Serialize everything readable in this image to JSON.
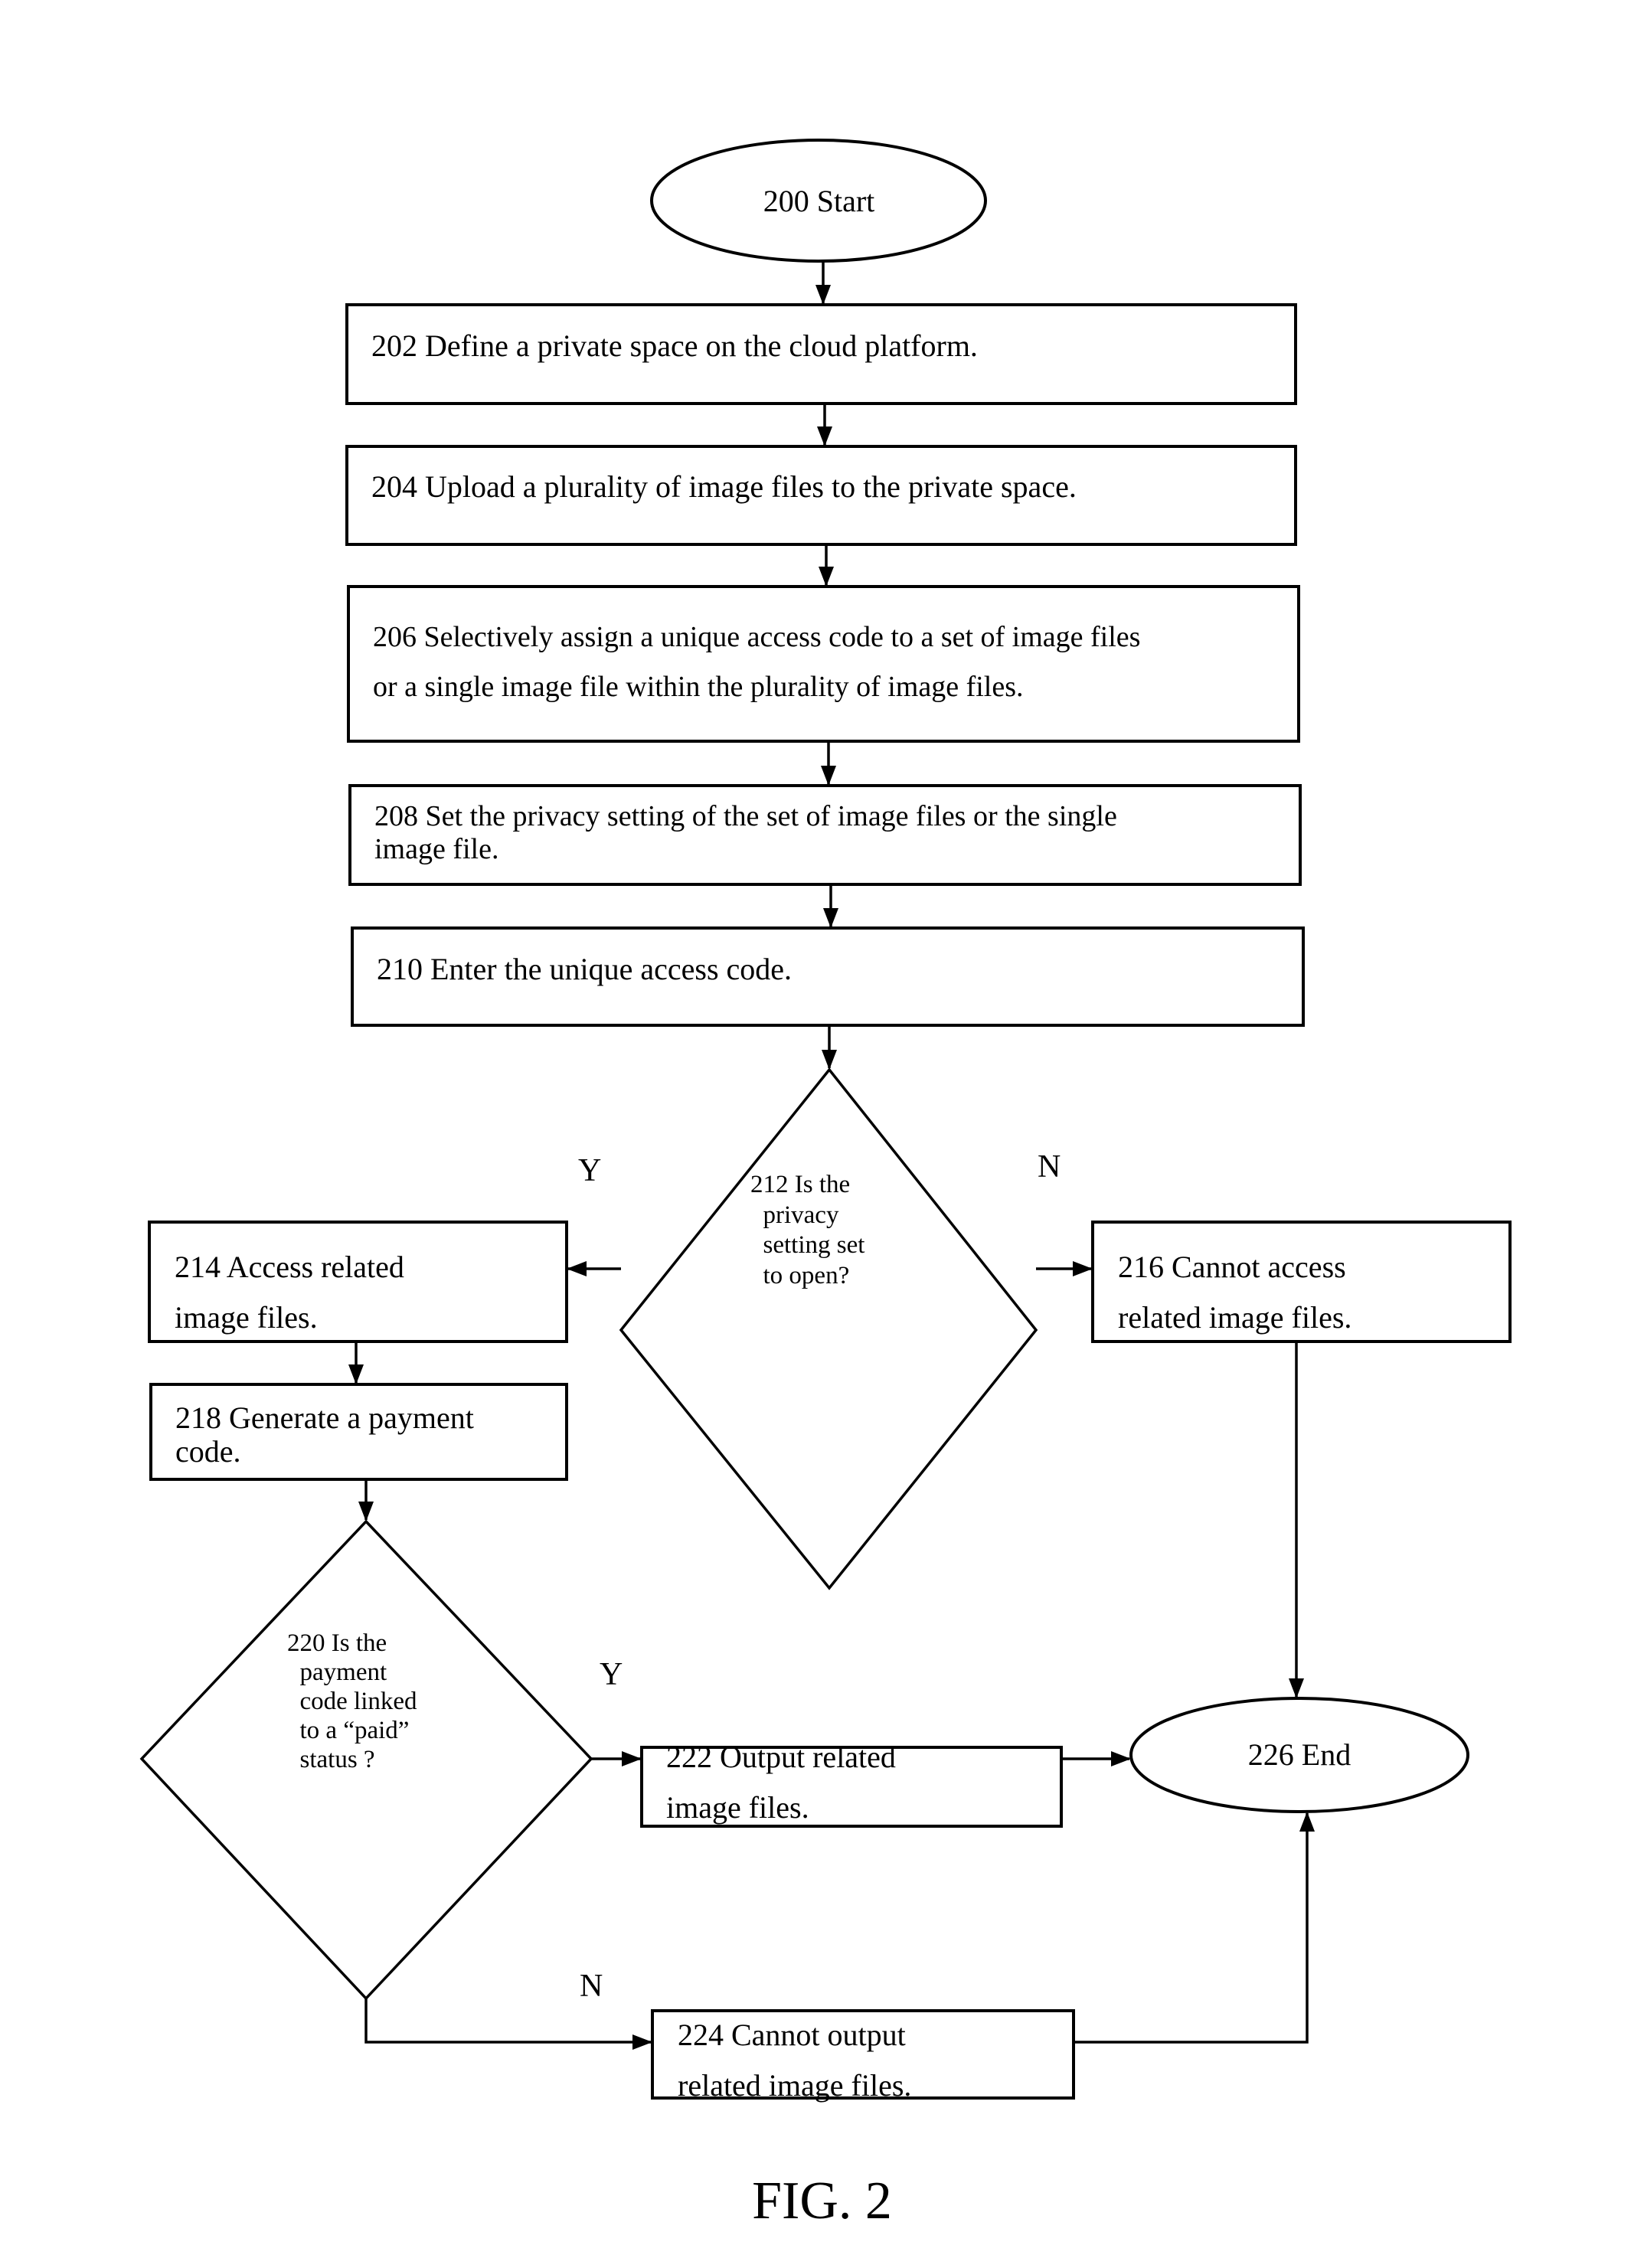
{
  "figure": {
    "caption": "FIG. 2"
  },
  "nodes": {
    "n200": {
      "id": "200",
      "shape": "oval",
      "text": "200 Start"
    },
    "n202": {
      "id": "202",
      "shape": "process",
      "text": "202 Define a private space on the cloud platform."
    },
    "n204": {
      "id": "204",
      "shape": "process",
      "text": "204 Upload a plurality of image files to the private space."
    },
    "n206": {
      "id": "206",
      "shape": "process",
      "text": "206 Selectively assign a unique access code to a set of image files\nor a single image file within the plurality of image files."
    },
    "n208": {
      "id": "208",
      "shape": "process",
      "text": "208 Set the privacy setting of the set of image files or the single\nimage file."
    },
    "n210": {
      "id": "210",
      "shape": "process",
      "text": "210 Enter the unique access code."
    },
    "n212": {
      "id": "212",
      "shape": "decision",
      "text": "212 Is the\n  privacy\n  setting set\n  to open?"
    },
    "n214": {
      "id": "214",
      "shape": "process",
      "text": "214 Access related\nimage files."
    },
    "n216": {
      "id": "216",
      "shape": "process",
      "text": "216 Cannot access\nrelated image files."
    },
    "n218": {
      "id": "218",
      "shape": "process",
      "text": "218 Generate a payment\ncode."
    },
    "n220": {
      "id": "220",
      "shape": "decision",
      "text": "220 Is the\n  payment\n  code linked\n  to a “paid”\n  status ?"
    },
    "n222": {
      "id": "222",
      "shape": "process",
      "text": "222 Output related\nimage files."
    },
    "n224": {
      "id": "224",
      "shape": "process",
      "text": "224 Cannot output\nrelated image files."
    },
    "n226": {
      "id": "226",
      "shape": "oval",
      "text": "226 End"
    }
  },
  "edges": [
    {
      "from": "200",
      "to": "202"
    },
    {
      "from": "202",
      "to": "204"
    },
    {
      "from": "204",
      "to": "206"
    },
    {
      "from": "206",
      "to": "208"
    },
    {
      "from": "208",
      "to": "210"
    },
    {
      "from": "210",
      "to": "212"
    },
    {
      "from": "212",
      "to": "214",
      "label": "Y"
    },
    {
      "from": "212",
      "to": "216",
      "label": "N"
    },
    {
      "from": "214",
      "to": "218"
    },
    {
      "from": "218",
      "to": "220"
    },
    {
      "from": "220",
      "to": "222",
      "label": "Y"
    },
    {
      "from": "220",
      "to": "224",
      "label": "N"
    },
    {
      "from": "222",
      "to": "226"
    },
    {
      "from": "216",
      "to": "226"
    },
    {
      "from": "224",
      "to": "226"
    }
  ],
  "branch_labels": {
    "d212_yes": "Y",
    "d212_no": "N",
    "d220_yes": "Y",
    "d220_no": "N"
  }
}
